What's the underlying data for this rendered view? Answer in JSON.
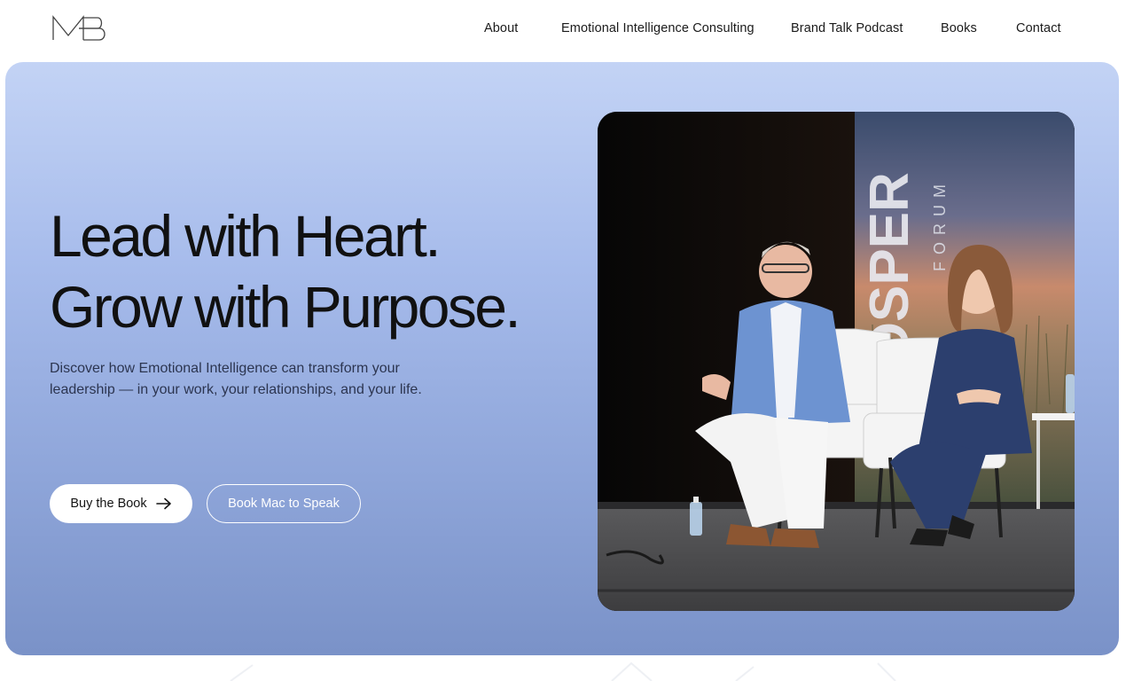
{
  "header": {
    "logo_text": "MB",
    "nav": [
      {
        "label": "About"
      },
      {
        "label": "Emotional Intelligence Consulting"
      },
      {
        "label": "Brand Talk Podcast"
      },
      {
        "label": "Books"
      },
      {
        "label": "Contact"
      }
    ]
  },
  "hero": {
    "headline_line1": "Lead with Heart.",
    "headline_line2": "Grow with Purpose.",
    "subtext": "Discover how Emotional Intelligence can transform your leadership — in your work, your relationships, and your life.",
    "primary_button": "Buy the Book",
    "secondary_button": "Book Mac to Speak",
    "photo_alt": "Two speakers seated in white armchairs on a stage in front of a Prosper Forum banner",
    "banner_text": "ROSPER",
    "banner_subtext": "FORUM"
  },
  "colors": {
    "hero_top": "#c3d3f5",
    "hero_bottom": "#7a92c8",
    "text_dark": "#141414",
    "button_bg": "#ffffff"
  }
}
